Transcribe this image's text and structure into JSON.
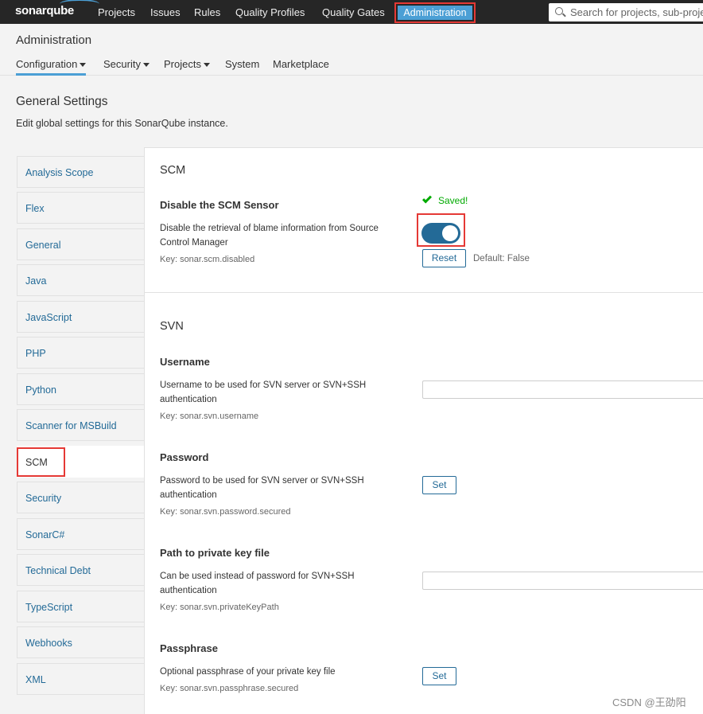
{
  "navbar": {
    "logo": "sonarqube",
    "links": [
      "Projects",
      "Issues",
      "Rules",
      "Quality Profiles",
      "Quality Gates"
    ],
    "active_link": "Administration",
    "search_placeholder": "Search for projects, sub-proje"
  },
  "admin": {
    "title": "Administration",
    "tabs": [
      {
        "label": "Configuration",
        "dropdown": true,
        "active": true
      },
      {
        "label": "Security",
        "dropdown": true
      },
      {
        "label": "Projects",
        "dropdown": true
      },
      {
        "label": "System",
        "dropdown": false
      },
      {
        "label": "Marketplace",
        "dropdown": false
      }
    ]
  },
  "page": {
    "title": "General Settings",
    "description": "Edit global settings for this SonarQube instance."
  },
  "sidebar": {
    "items": [
      "Analysis Scope",
      "Flex",
      "General",
      "Java",
      "JavaScript",
      "PHP",
      "Python",
      "Scanner for MSBuild",
      "SCM",
      "Security",
      "SonarC#",
      "Technical Debt",
      "TypeScript",
      "Webhooks",
      "XML"
    ],
    "active": "SCM"
  },
  "scm": {
    "section_title": "SCM",
    "setting": {
      "name": "Disable the SCM Sensor",
      "description": "Disable the retrieval of blame information from Source Control Manager",
      "key": "Key: sonar.scm.disabled",
      "saved_label": "Saved!",
      "toggle_on": true,
      "reset_label": "Reset",
      "default_text": "Default: False"
    }
  },
  "svn": {
    "section_title": "SVN",
    "username": {
      "name": "Username",
      "description": "Username to be used for SVN server or SVN+SSH authentication",
      "key": "Key: sonar.svn.username",
      "value": ""
    },
    "password": {
      "name": "Password",
      "description": "Password to be used for SVN server or SVN+SSH authentication",
      "key": "Key: sonar.svn.password.secured",
      "button": "Set"
    },
    "private_key": {
      "name": "Path to private key file",
      "description": "Can be used instead of password for SVN+SSH authentication",
      "key": "Key: sonar.svn.privateKeyPath",
      "value": ""
    },
    "passphrase": {
      "name": "Passphrase",
      "description": "Optional passphrase of your private key file",
      "key": "Key: sonar.svn.passphrase.secured",
      "button": "Set"
    }
  },
  "watermark": "CSDN @王劭阳",
  "colors": {
    "navbar": "#262626",
    "accent": "#4b9fd5",
    "link": "#236a97",
    "highlight_box": "#e53935",
    "saved": "#00aa00"
  }
}
